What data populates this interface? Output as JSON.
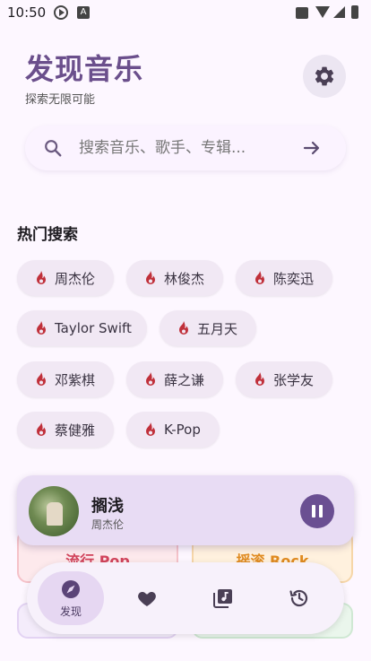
{
  "status_bar": {
    "time": "10:50",
    "icons": [
      "play-circle-icon",
      "a-notification-icon",
      "bag-icon",
      "wifi-icon",
      "signal-icon",
      "battery-icon"
    ]
  },
  "header": {
    "title": "发现音乐",
    "subtitle": "探索无限可能",
    "settings_icon": "gear-icon"
  },
  "search": {
    "placeholder": "搜索音乐、歌手、专辑..."
  },
  "hot_search": {
    "title": "热门搜索",
    "chips": [
      "周杰伦",
      "林俊杰",
      "陈奕迅",
      "Taylor Swift",
      "五月天",
      "邓紫棋",
      "薛之谦",
      "张学友",
      "蔡健雅",
      "K-Pop"
    ]
  },
  "genres": {
    "pop": "流行 Pop",
    "rock": "摇滚 Rock"
  },
  "now_playing": {
    "title": "搁浅",
    "artist": "周杰伦",
    "state_icon": "pause-icon"
  },
  "bottom_nav": {
    "items": [
      {
        "label": "发现",
        "icon": "compass-icon",
        "active": true
      },
      {
        "label": "",
        "icon": "heart-icon",
        "active": false
      },
      {
        "label": "",
        "icon": "music-library-icon",
        "active": false
      },
      {
        "label": "",
        "icon": "history-icon",
        "active": false
      }
    ]
  },
  "colors": {
    "accent": "#6b4f8c",
    "background": "#fdf7ff",
    "chip": "#f1e8f4",
    "fire": "#c0303a"
  }
}
